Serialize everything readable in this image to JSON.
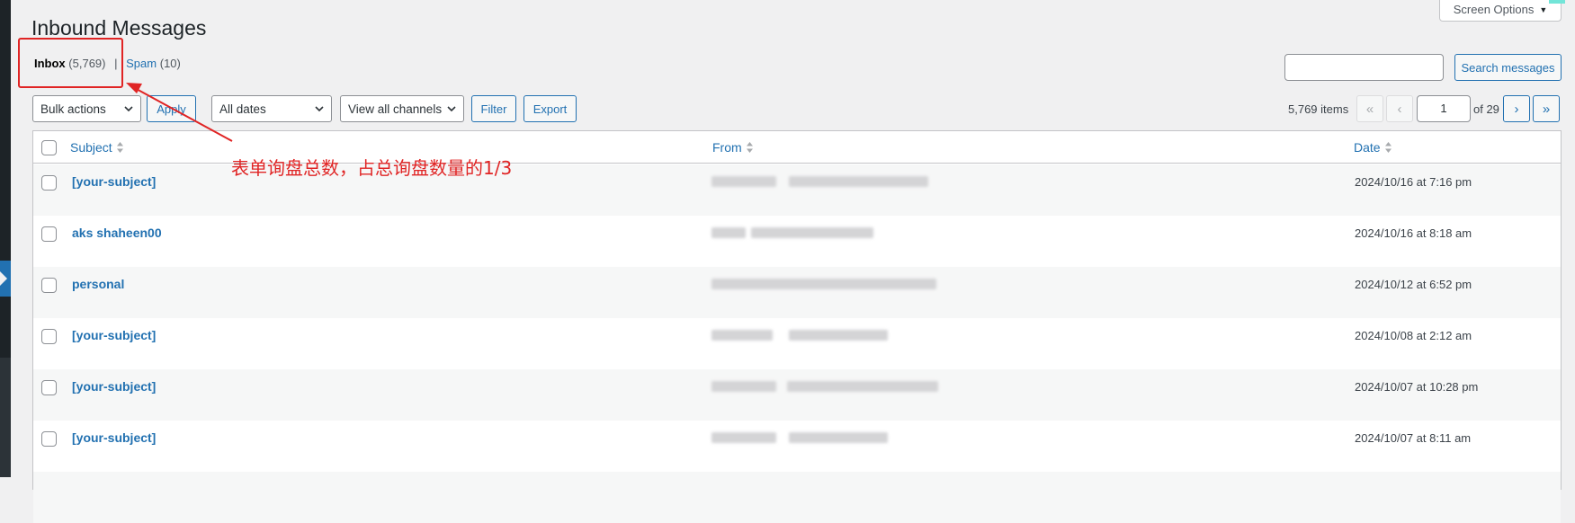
{
  "page": {
    "title": "Inbound Messages"
  },
  "screen_options": {
    "label": "Screen Options"
  },
  "views": {
    "inbox_label": "Inbox",
    "inbox_count": "(5,769)",
    "separator": "|",
    "spam_label": "Spam",
    "spam_count": "(10)"
  },
  "search": {
    "value": "",
    "button_label": "Search messages"
  },
  "toolbar": {
    "bulk_actions": "Bulk actions",
    "apply_label": "Apply",
    "dates_filter": "All dates",
    "channels_filter": "View all channels",
    "filter_label": "Filter",
    "export_label": "Export"
  },
  "pagination": {
    "items_count": "5,769 items",
    "first": "«",
    "prev": "‹",
    "current_page": "1",
    "total_text": "of 29",
    "next": "›",
    "last": "»"
  },
  "table": {
    "columns": [
      "Subject",
      "From",
      "Date"
    ],
    "rows": [
      {
        "subject": "[your-subject]",
        "date": "2024/10/16 at 7:16 pm"
      },
      {
        "subject": "aks shaheen00",
        "date": "2024/10/16 at 8:18 am"
      },
      {
        "subject": "personal",
        "date": "2024/10/12 at 6:52 pm"
      },
      {
        "subject": "[your-subject]",
        "date": "2024/10/08 at 2:12 am"
      },
      {
        "subject": "[your-subject]",
        "date": "2024/10/07 at 10:28 pm"
      },
      {
        "subject": "[your-subject]",
        "date": "2024/10/07 at 8:11 am"
      }
    ]
  },
  "annotation": {
    "text": "表单询盘总数，占总询盘数量的1/3",
    "color": "#e02424"
  },
  "colors": {
    "accent": "#2271b1",
    "background": "#f0f0f1",
    "admin_bar": "#1d2327"
  }
}
